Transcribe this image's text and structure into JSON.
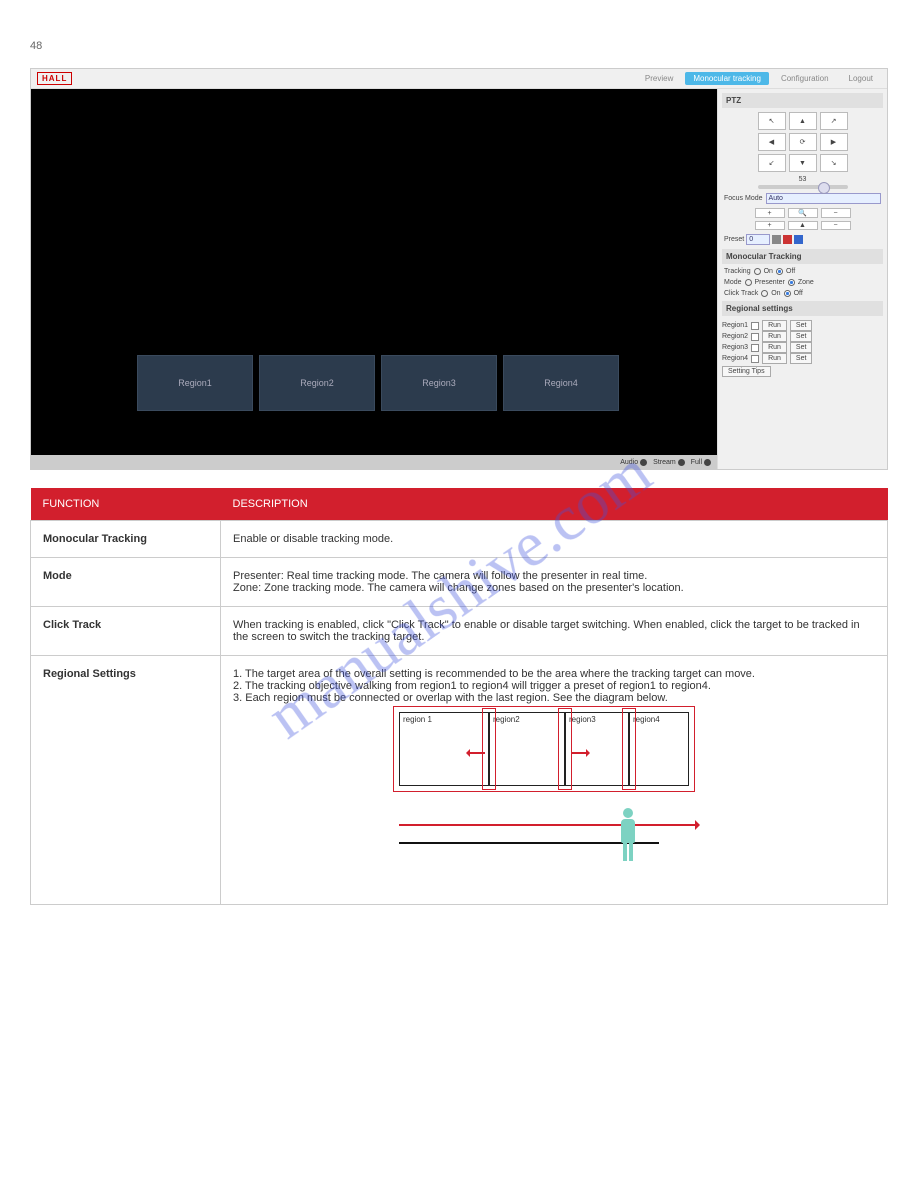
{
  "watermark": "manualshive.com",
  "page_number": "48",
  "app": {
    "logo": "HALL",
    "nav": {
      "preview": "Preview",
      "tracking": "Monocular tracking",
      "config": "Configuration",
      "logout": "Logout"
    },
    "regions": {
      "r1": "Region1",
      "r2": "Region2",
      "r3": "Region3",
      "r4": "Region4"
    },
    "viewport_bar": {
      "audio": "Audio",
      "stream": "Stream",
      "full": "Full"
    },
    "ptz": {
      "title": "PTZ",
      "arrows": {
        "ul": "↖",
        "u": "▲",
        "ur": "↗",
        "l": "◀",
        "c": "⟳",
        "r": "▶",
        "dl": "↙",
        "d": "▼",
        "dr": "↘"
      },
      "speed": "53",
      "focus_mode_lbl": "Focus Mode",
      "focus_mode_val": "Auto",
      "zoom": {
        "plus": "+",
        "mag": "🔍",
        "minus": "−",
        "plus2": "+",
        "focus": "▲",
        "minus2": "−"
      },
      "preset_lbl": "Preset",
      "preset_val": "0"
    },
    "mtrack": {
      "title": "Monocular Tracking",
      "tracking_lbl": "Tracking",
      "on": "On",
      "off": "Off",
      "mode_lbl": "Mode",
      "presenter": "Presenter",
      "zone": "Zone",
      "click_lbl": "Click Track"
    },
    "regional": {
      "title": "Regional settings",
      "rows": [
        {
          "label": "Region1",
          "run": "Run",
          "set": "Set"
        },
        {
          "label": "Region2",
          "run": "Run",
          "set": "Set"
        },
        {
          "label": "Region3",
          "run": "Run",
          "set": "Set"
        },
        {
          "label": "Region4",
          "run": "Run",
          "set": "Set"
        }
      ],
      "tips": "Setting Tips"
    }
  },
  "table": {
    "head_f": "FUNCTION",
    "head_d": "DESCRIPTION",
    "rows": [
      {
        "f": "Monocular Tracking",
        "d": "Enable or disable tracking mode."
      },
      {
        "f": "Mode",
        "d": "Presenter: Real time tracking mode. The camera will follow the presenter in real time.\nZone: Zone tracking mode. The camera will change zones based on the presenter's location."
      },
      {
        "f": "Click Track",
        "d": "When tracking is enabled, click \"Click Track\" to enable or disable target switching. When enabled, click the target to be tracked in the screen to switch the tracking target."
      }
    ],
    "regional": {
      "f": "Regional Settings",
      "d": "1. The target area of the overall setting is recommended to be the area where the tracking target can move.\n2. The tracking objective walking from region1 to region4 will trigger a preset of region1 to region4.\n3. Each region must be connected or overlap with the last region. See the diagram below."
    }
  },
  "diagram": {
    "r1": "region 1",
    "r2": "region2",
    "r3": "region3",
    "r4": "region4"
  }
}
